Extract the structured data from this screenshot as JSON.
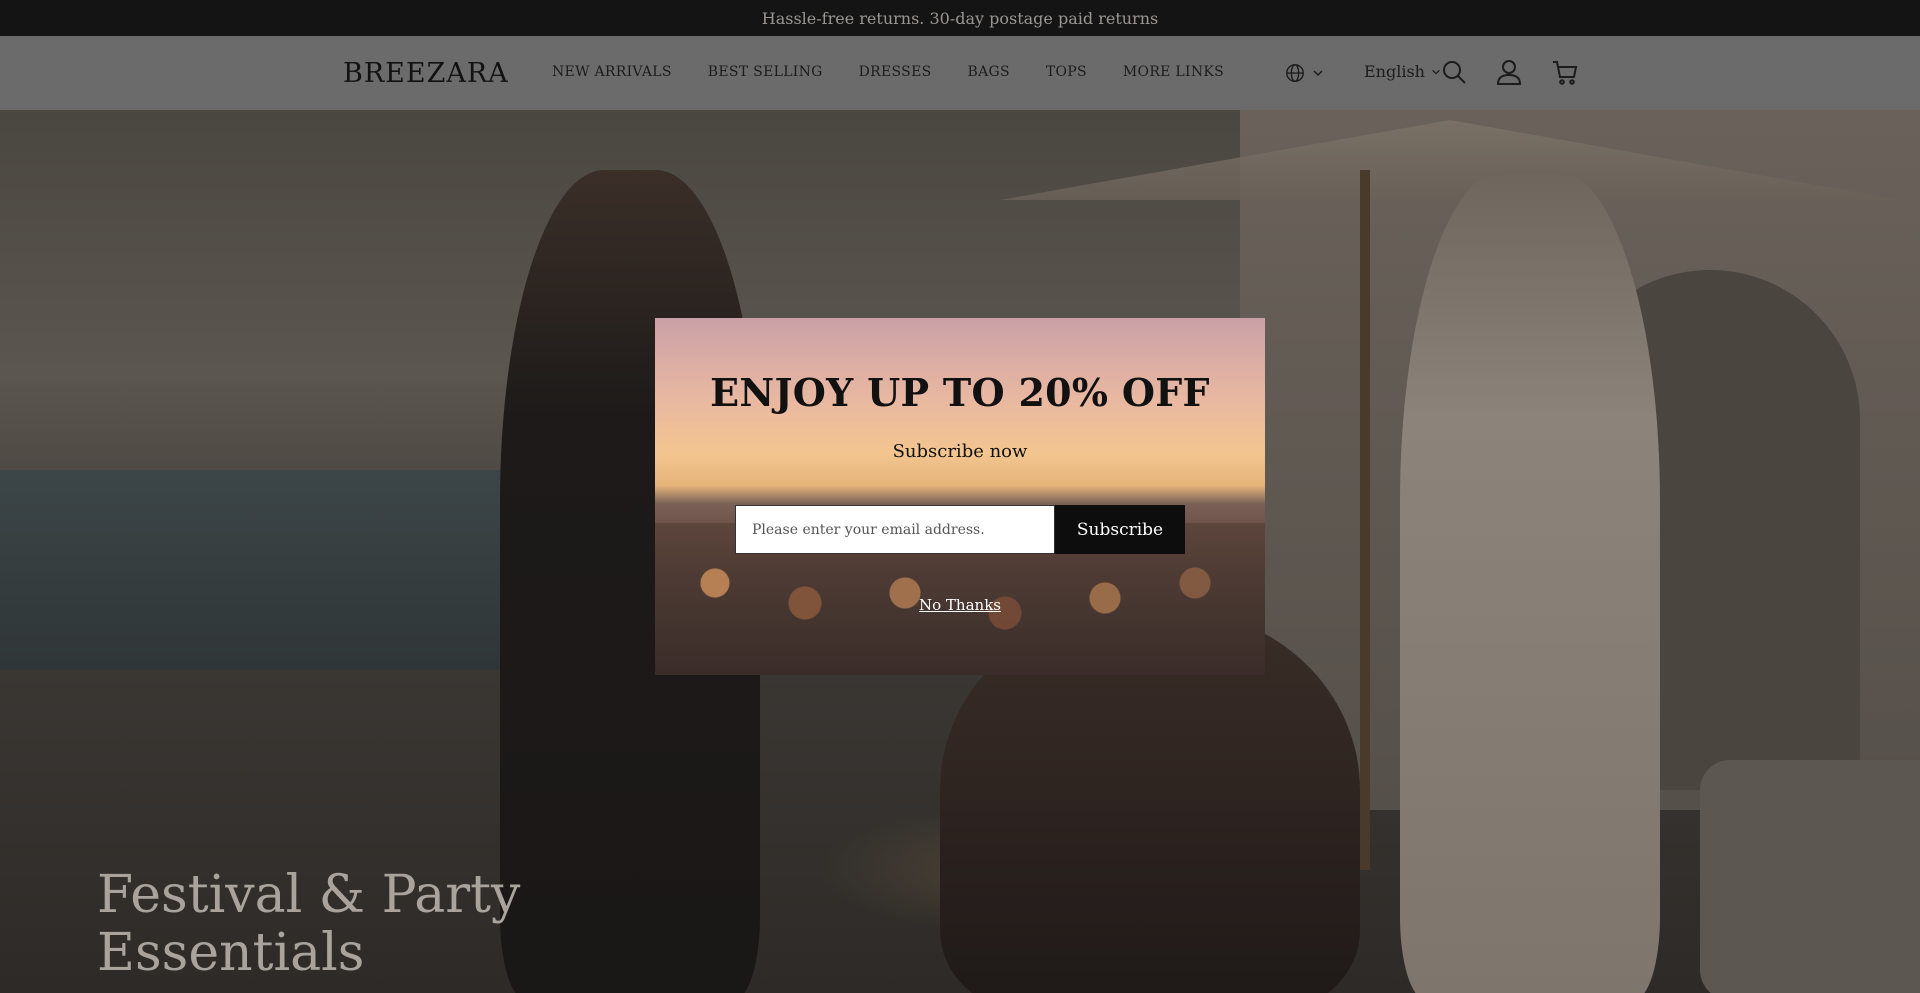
{
  "announcement": {
    "text": "Hassle-free returns. 30-day postage paid returns"
  },
  "header": {
    "logo": "BREEZARA",
    "nav": [
      "NEW ARRIVALS",
      "BEST SELLING",
      "DRESSES",
      "BAGS",
      "TOPS",
      "MORE LINKS"
    ],
    "language": "English",
    "icons": [
      "globe-icon",
      "chevron-down-icon",
      "search-icon",
      "account-icon",
      "cart-icon"
    ]
  },
  "hero": {
    "title_line1": "Festival & Party",
    "title_line2": "Essentials"
  },
  "popup": {
    "title": "ENJOY UP TO 20% OFF",
    "subtitle": "Subscribe now",
    "email_placeholder": "Please enter your email address.",
    "subscribe_label": "Subscribe",
    "dismiss_label": "No Thanks"
  },
  "colors": {
    "announcement_bg": "#151414",
    "header_bg": "#6b6b6b",
    "button_bg": "#0d0d0d"
  }
}
